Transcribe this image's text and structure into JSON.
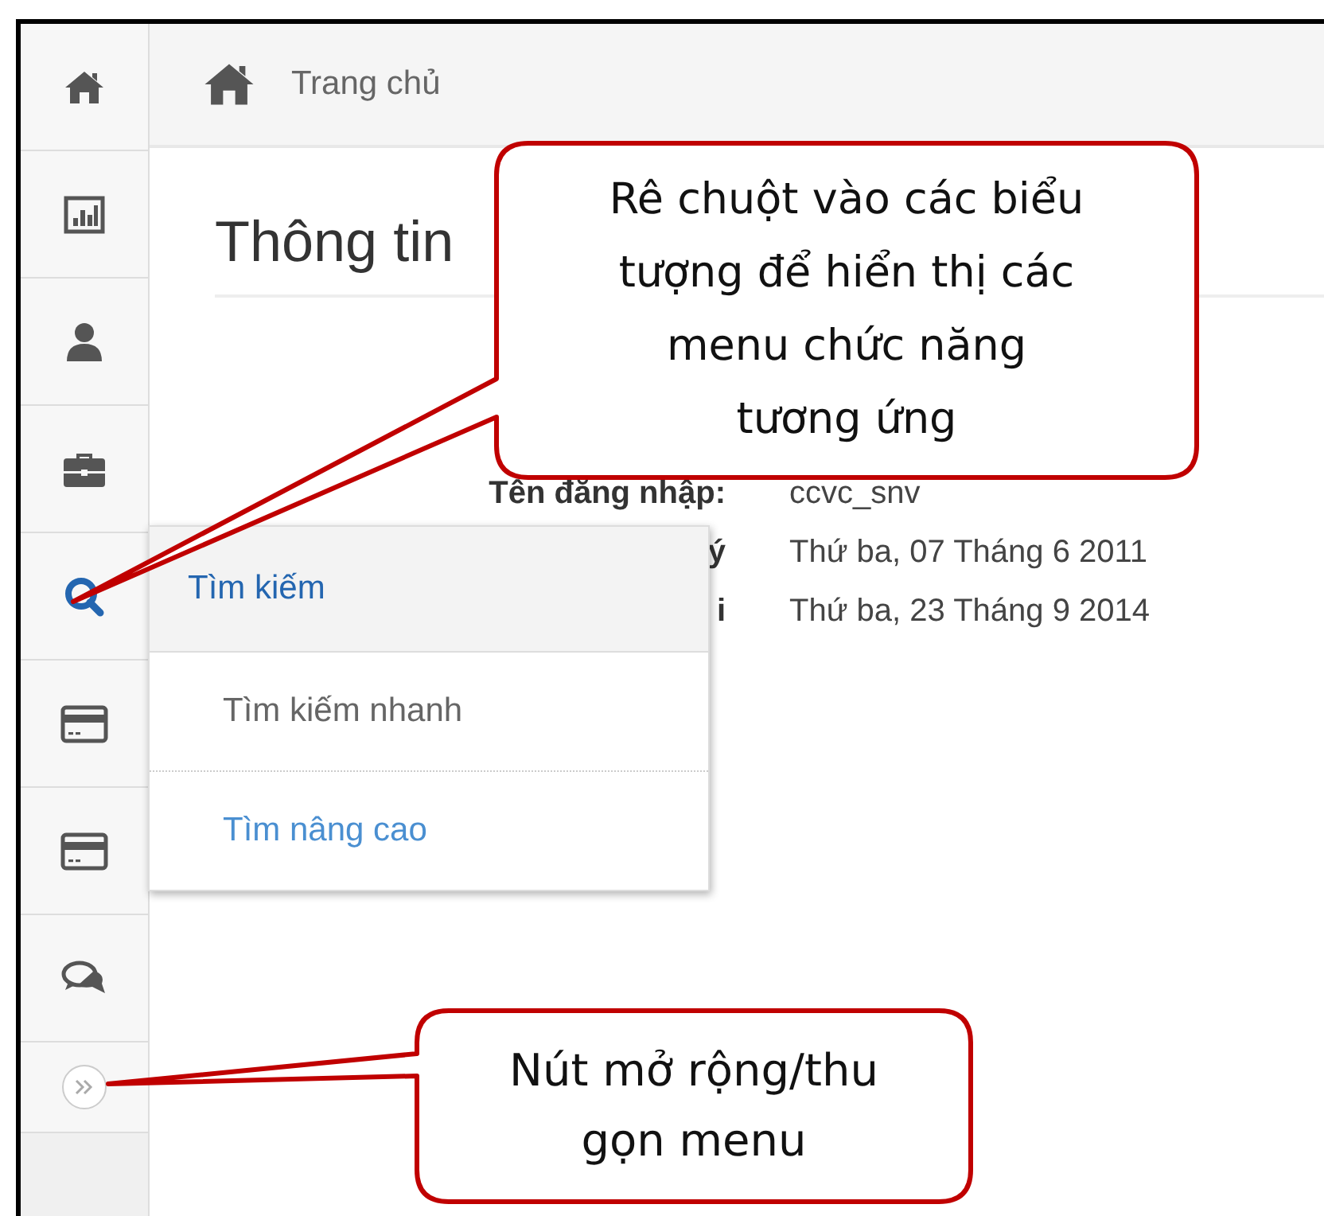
{
  "sidebar": {
    "items": [
      {
        "kind": "home",
        "selected": false
      },
      {
        "kind": "chart",
        "selected": false
      },
      {
        "kind": "user",
        "selected": false
      },
      {
        "kind": "briefcase",
        "selected": false
      },
      {
        "kind": "search",
        "selected": true
      },
      {
        "kind": "card",
        "selected": false
      },
      {
        "kind": "card",
        "selected": false
      },
      {
        "kind": "chat",
        "selected": false
      }
    ],
    "toggle": {
      "expanded": false
    }
  },
  "breadcrumb": {
    "label": "Trang chủ"
  },
  "page_title": "Thông tin",
  "info_rows": [
    {
      "label": "Tên đăng nhập:",
      "value": "ccvc_snv"
    },
    {
      "label": "ý",
      "value": "Thứ ba, 07 Tháng 6 2011"
    },
    {
      "label": "i",
      "value": "Thứ ba, 23 Tháng 9 2014"
    }
  ],
  "flyout_menu": {
    "title": "Tìm kiếm",
    "items": [
      {
        "label": "Tìm kiếm nhanh",
        "color": "#666666"
      },
      {
        "label": "Tìm nâng cao",
        "color": "#4a8fd1"
      }
    ]
  },
  "callouts": [
    {
      "lines": [
        "Rê chuột vào các biểu",
        "tượng để hiển thị các",
        "menu chức năng",
        "tương ứng"
      ]
    },
    {
      "lines": [
        "Nút mở rộng/thu",
        "gọn menu"
      ]
    }
  ]
}
